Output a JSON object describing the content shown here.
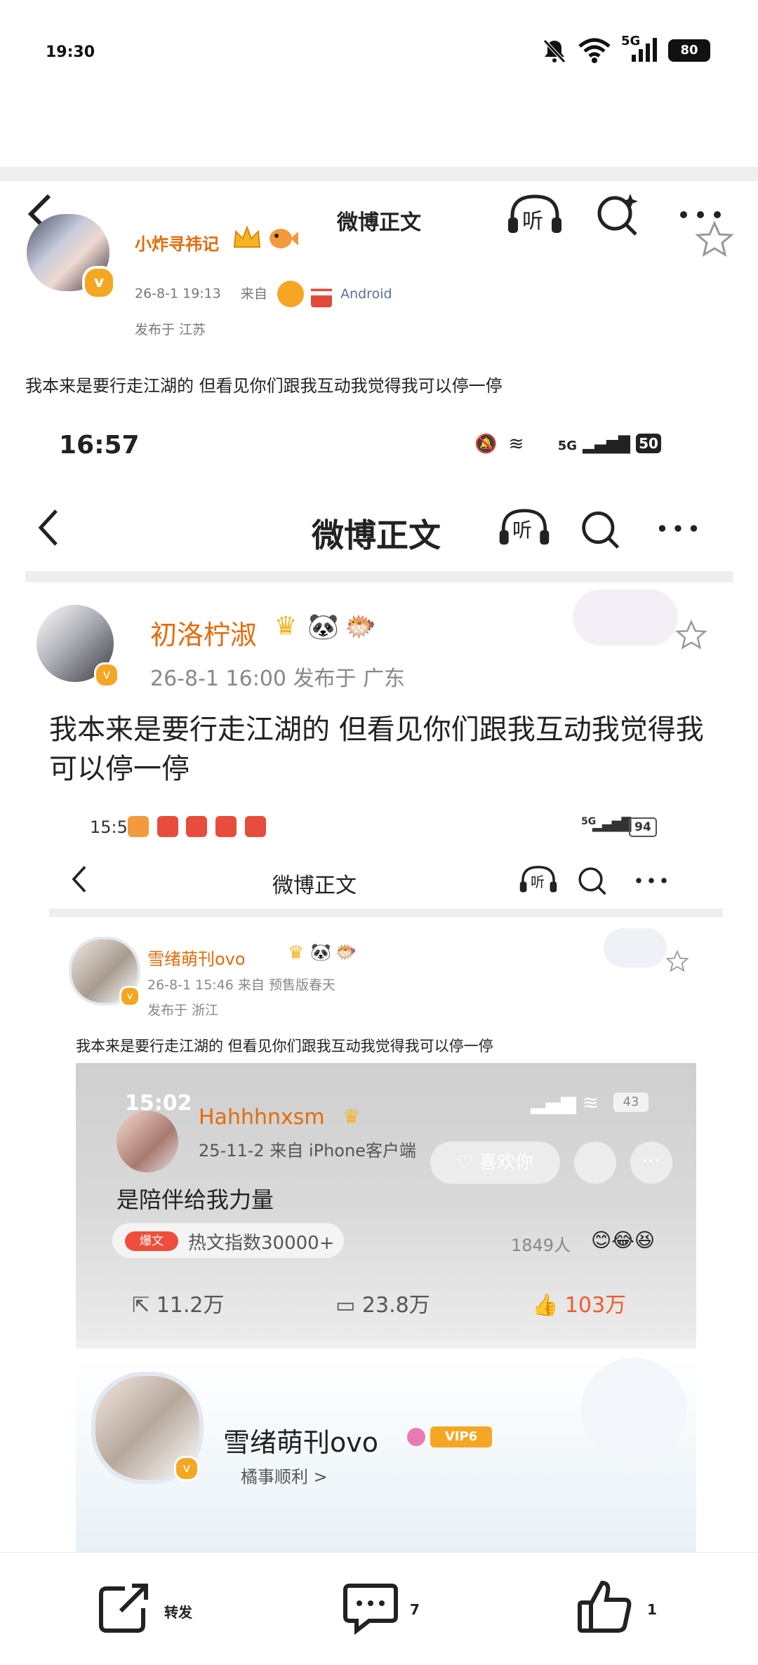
{
  "status_bar": {
    "time": "19:30",
    "network": "5G",
    "battery": "80"
  },
  "nav": {
    "title": "微博正文",
    "listen_label": "听"
  },
  "post": {
    "author": "小炸寻祎记",
    "date": "26-8-1 19:13",
    "from_label": "来自",
    "source": "Android",
    "location": "发布于 江苏",
    "text": "我本来是要行走江湖的 但看见你们跟我互动我觉得我可以停一停"
  },
  "screenshot1": {
    "time": "16:57",
    "network": "5G",
    "battery": "50",
    "nav_title": "微博正文",
    "listen_label": "听",
    "author": "初洛柠淑",
    "meta": "26-8-1 16:00  发布于 广东",
    "text": "我本来是要行走江湖的 但看见你们跟我互动我觉得我可以停一停"
  },
  "screenshot2": {
    "time": "15:57",
    "network": "5G",
    "battery": "94",
    "nav_title": "微博正文",
    "listen_label": "听",
    "author": "雪绪萌刊ovo",
    "meta1": "26-8-1 15:46  来自 预售版春天",
    "meta2": "发布于 浙江",
    "text": "我本来是要行走江湖的 但看见你们跟我互动我觉得我可以停一停"
  },
  "screenshot3": {
    "time": "15:02",
    "battery": "43",
    "author": "Hahhhnxsm",
    "meta": "25-11-2  来自 iPhone客户端",
    "like_button": "喜欢你",
    "text": "是陪伴给我力量",
    "hot_tag": "爆文",
    "hot_text": "热文指数30000+",
    "likers": "1849人",
    "shares": "11.2万",
    "comments": "23.8万",
    "likes": "103万",
    "profile_name": "雪绪萌刊ovo",
    "vip": "VIP6",
    "profile_sub": "橘事顺利 >"
  },
  "bottom_bar": {
    "repost_label": "转发",
    "comment_count": "7",
    "like_count": "1"
  },
  "colors": {
    "accent_orange": "#e36c0a",
    "link_blue": "#5a6f96",
    "vip_gold": "#f5a623"
  }
}
